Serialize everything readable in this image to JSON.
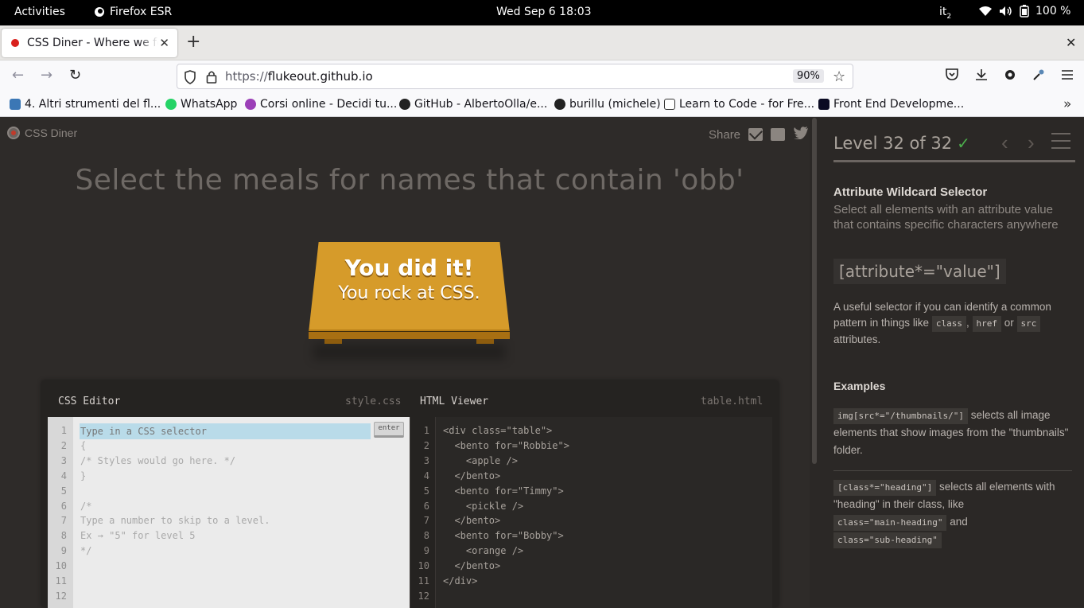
{
  "os": {
    "activities": "Activities",
    "app": "Firefox ESR",
    "clock": "Wed Sep 6  18:03",
    "keyboard": "it",
    "keyboard_sub": "2",
    "battery": "100 %"
  },
  "browser": {
    "tab_title": "CSS Diner - Where we feast on CSS",
    "url_scheme": "https://",
    "url_host": "flukeout.github.io",
    "zoom": "90%",
    "bookmarks": [
      "4. Altri strumenti del fl...",
      "WhatsApp",
      "Corsi online - Decidi tu...",
      "GitHub - AlbertoOlla/e...",
      "burillu (michele)",
      "Learn to Code - for Fre...",
      "Front End Developme..."
    ]
  },
  "game": {
    "brand": "CSS Diner",
    "share": "Share",
    "instruction": "Select the meals for names that contain 'obb'",
    "win_line1": "You did it!",
    "win_line2": "You rock at CSS.",
    "css_editor_title": "CSS Editor",
    "css_file": "style.css",
    "html_viewer_title": "HTML Viewer",
    "html_file": "table.html",
    "input_placeholder": "Type in a CSS selector",
    "enter_label": "enter",
    "line_numbers": [
      "1",
      "2",
      "3",
      "4",
      "5",
      "6",
      "7",
      "8",
      "9",
      "10",
      "11",
      "12"
    ],
    "css_lines": [
      "",
      "{",
      "/* Styles would go here. */",
      "}",
      "",
      "/*",
      "Type a number to skip to a level.",
      "Ex → \"5\" for level 5",
      "*/",
      "",
      "",
      ""
    ],
    "html_lines": [
      "<div class=\"table\">",
      "  <bento for=\"Robbie\">",
      "    <apple />",
      "  </bento>",
      "  <bento for=\"Timmy\">",
      "    <pickle />",
      "  </bento>",
      "  <bento for=\"Bobby\">",
      "    <orange />",
      "  </bento>",
      "</div>",
      ""
    ]
  },
  "sidebar": {
    "level": "Level 32 of 32",
    "check": "✓",
    "progress": 1.0,
    "selector_name": "Attribute Wildcard Selector",
    "selector_title": "Select all elements with an attribute value that contains specific characters anywhere",
    "syntax": "[attribute*=\"value\"]",
    "hint_pre": "A useful selector if you can identify a common pattern in things like",
    "hint_tag1": "class",
    "hint_sep": ",",
    "hint_tag2": "href",
    "hint_or": "or",
    "hint_tag3": "src",
    "hint_post": "attributes.",
    "examples_heading": "Examples",
    "ex1_code": "img[src*=\"/thumbnails/\"]",
    "ex1_text": "selects all image elements that show images from the \"thumbnails\" folder.",
    "ex2_code": "[class*=\"heading\"]",
    "ex2_text": "selects all elements with \"heading\" in their class, like",
    "ex2_tag1": "class=\"main-heading\"",
    "ex2_and": "and",
    "ex2_tag2": "class=\"sub-heading\""
  }
}
